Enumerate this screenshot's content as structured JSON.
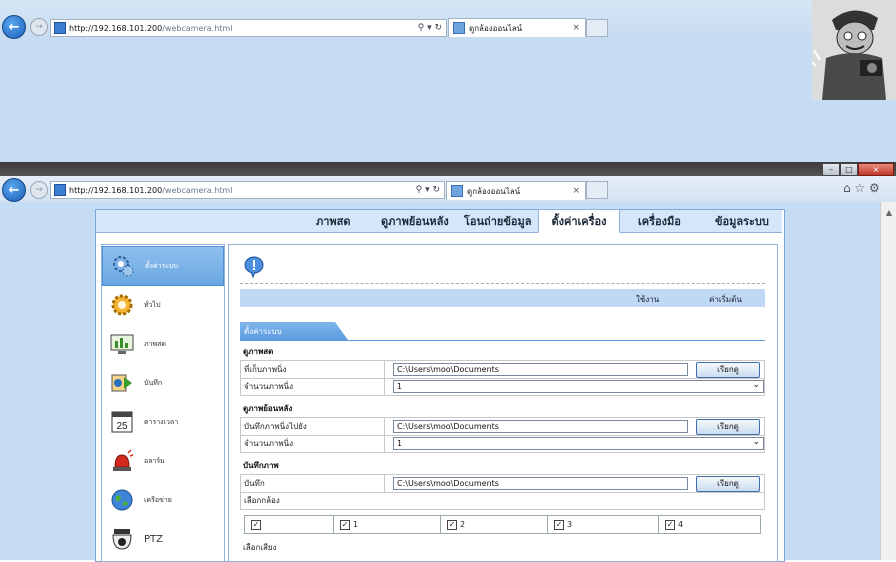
{
  "browser1": {
    "url_host": "http://192.168.101.200",
    "url_path": "/webcamera.html",
    "addr_ctrls": "⚲ ▾ ↻",
    "tab_title": "ดูกล้องออนไลน์",
    "tab_close": "×"
  },
  "browser2": {
    "url_host": "http://192.168.101.200",
    "url_path": "/webcamera.html",
    "addr_ctrls": "⚲ ▾ ↻",
    "tab_title": "ดูกล้องออนไลน์",
    "tab_close": "×",
    "win_min": "–",
    "win_max": "□",
    "win_close": "×",
    "icons_right": "⌂ ☆ ⚙"
  },
  "menu": {
    "items": [
      "ภาพสด",
      "ดูภาพย้อนหลัง",
      "โอนถ่ายข้อมูล",
      "ตั้งค่าเครื่อง",
      "เครื่องมือ",
      "ข้อมูลระบบ"
    ],
    "active_index": 3
  },
  "sidebar": {
    "items": [
      {
        "label": "ตั้งค่าระบบ",
        "icon": "system-settings-icon"
      },
      {
        "label": "ทั่วไป",
        "icon": "general-gear-icon"
      },
      {
        "label": "ภาพสด",
        "icon": "live-view-monitor-icon"
      },
      {
        "label": "บันทึก",
        "icon": "record-icon"
      },
      {
        "label": "ตารางเวลา",
        "icon": "calendar-icon"
      },
      {
        "label": "อลาร์ม",
        "icon": "alarm-siren-icon"
      },
      {
        "label": "เครือข่าย",
        "icon": "network-globe-icon"
      },
      {
        "label": "PTZ",
        "icon": "ptz-camera-icon"
      }
    ],
    "active_index": 0
  },
  "panel": {
    "header_apply": "ใช้งาน",
    "header_default": "ค่าเริ่มต้น",
    "section_tab": "ตั้งค่าระบบ",
    "groups": {
      "live": "ดูภาพสด",
      "playback": "ดูภาพย้อนหลัง",
      "record": "บันทึกภาพ"
    },
    "live_snapshot_label": "ที่เก็บภาพนิ่ง",
    "live_snapshot_path": "C:\\Users\\moo\\Documents",
    "live_count_label": "จำนวนภาพนิ่ง",
    "live_count_value": "1",
    "playback_save_label": "บันทึกภาพนิ่งไปยัง",
    "playback_save_path": "C:\\Users\\moo\\Documents",
    "playback_count_label": "จำนวนภาพนิ่ง",
    "playback_count_value": "1",
    "record_label": "บันทึก",
    "record_path": "C:\\Users\\moo\\Documents",
    "browse_label": "เรียกดู",
    "select_camera_label": "เลือกกล้อง",
    "camera_checks": [
      "",
      "1",
      "2",
      "3",
      "4"
    ],
    "select_audio_label": "เลือกเสียง"
  },
  "colors": {
    "accent": "#5d9be0",
    "menubar": "#d5e6f8",
    "page_bg": "#c6dcf4"
  }
}
